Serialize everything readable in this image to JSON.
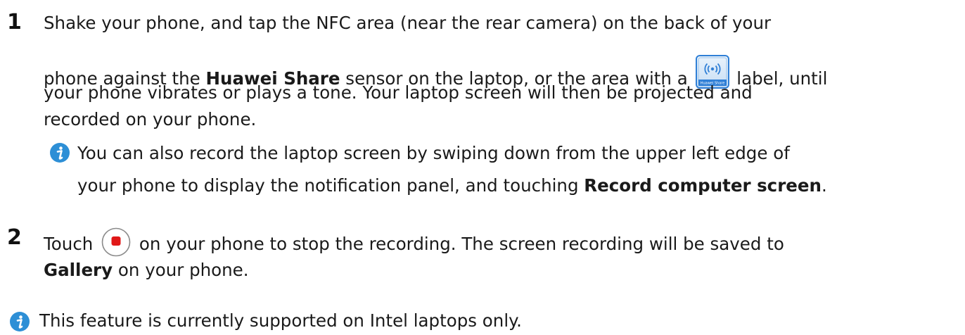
{
  "step1": {
    "number": "1",
    "line1": "Shake your phone, and tap the NFC area (near the rear camera) on the back of your",
    "line2_a": "phone against the ",
    "line2_bold": "Huawei Share",
    "line2_b": " sensor on the laptop, or the area with a ",
    "line2_c": " label, until",
    "badge_text": "Huawei Share",
    "line3": "your phone vibrates or plays a tone. Your laptop screen will then be projected and",
    "line4": "recorded on your phone.",
    "note_line1": "You can also record the laptop screen by swiping down from the upper left edge of",
    "note_line2_a": "your phone to display the notification panel, and touching ",
    "note_line2_bold": "Record computer screen",
    "note_line2_b": "."
  },
  "step2": {
    "number": "2",
    "line1_a": "Touch ",
    "line1_b": " on your phone to stop the recording. The screen recording will be saved to",
    "line2_bold": "Gallery",
    "line2_b": " on your phone."
  },
  "final_note": "This feature is currently supported on Intel laptops only.",
  "colors": {
    "info_icon": "#2d8fd6",
    "badge_blue": "#2f7fd6",
    "stop_red": "#e01818"
  }
}
